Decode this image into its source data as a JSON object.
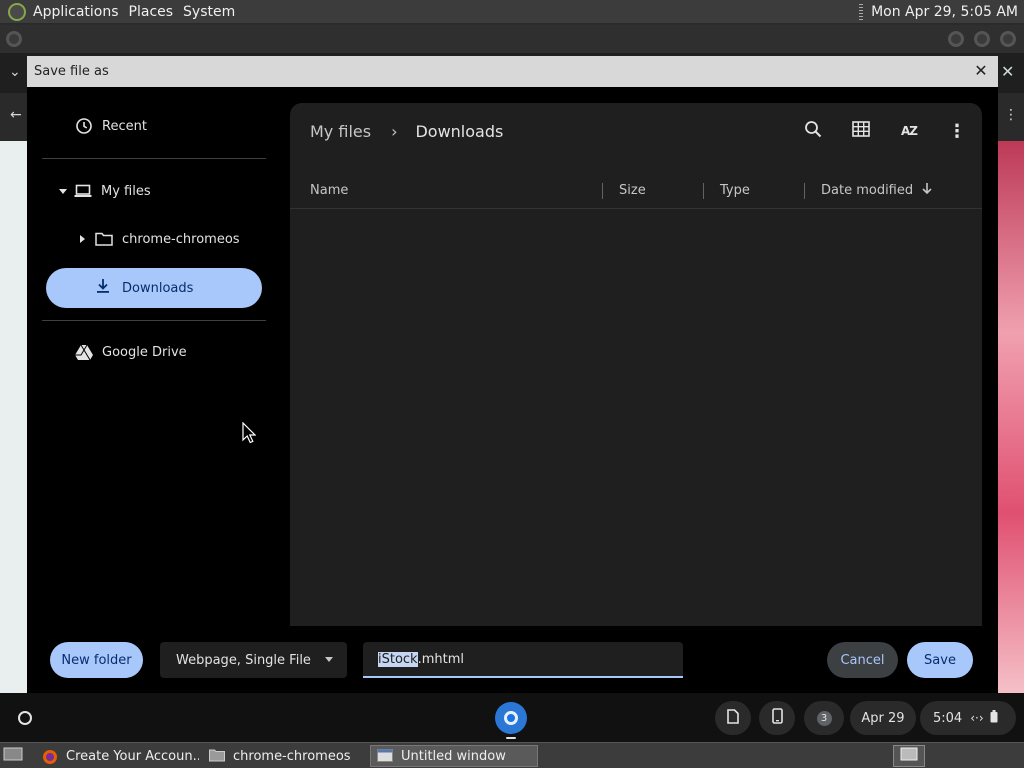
{
  "top_panel": {
    "menus": [
      "Applications",
      "Places",
      "System"
    ],
    "clock": "Mon Apr 29,  5:05 AM"
  },
  "dialog": {
    "title": "Save file as",
    "sidebar": {
      "recent": "Recent",
      "my_files": "My files",
      "chrome_chromeos": "chrome-chromeos",
      "downloads": "Downloads",
      "google_drive": "Google Drive"
    },
    "breadcrumb": {
      "root": "My files",
      "separator": "›",
      "current": "Downloads"
    },
    "columns": {
      "name": "Name",
      "size": "Size",
      "type": "Type",
      "date_modified": "Date modified"
    },
    "sort_button_label": "AZ",
    "footer": {
      "new_folder": "New folder",
      "file_type": "Webpage, Single File",
      "filename_selected": "iStock",
      "filename_rest": ".mhtml",
      "cancel": "Cancel",
      "save": "Save"
    }
  },
  "shelf": {
    "notification_count": "3",
    "date": "Apr 29",
    "time": "5:04"
  },
  "taskbar": {
    "tasks": [
      "Create Your Accoun...",
      "chrome-chromeos",
      "Untitled window"
    ]
  },
  "colors": {
    "accent": "#a8c7fa",
    "accent_text": "#062e6f",
    "panel_bg": "#1f1f1f",
    "dialog_bg": "#000000"
  }
}
